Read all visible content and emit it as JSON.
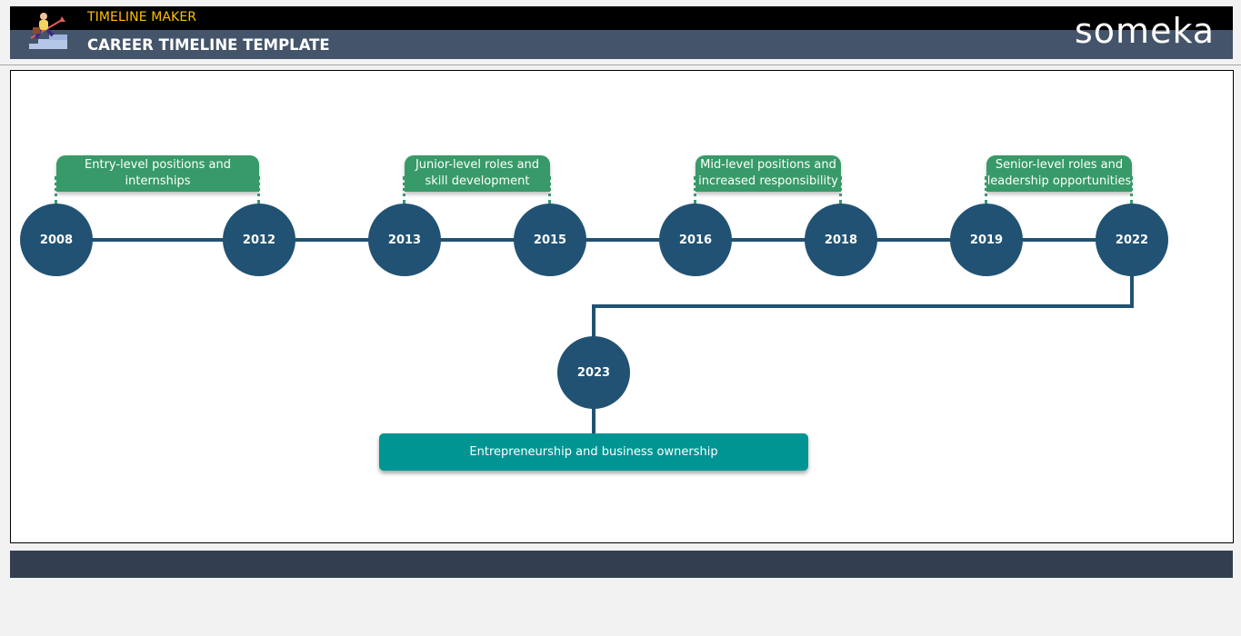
{
  "header": {
    "app_name": "TIMELINE MAKER",
    "page_title": "CAREER TIMELINE TEMPLATE",
    "brand": "someka",
    "icon": "career-stairs-icon"
  },
  "colors": {
    "node": "#215273",
    "phase_box": "#389a68",
    "final_box": "#009593",
    "header_top": "#000000",
    "header_bottom": "#44546a",
    "accent_text": "#ffc000",
    "footer": "#333f50"
  },
  "timeline": {
    "years": [
      "2008",
      "2012",
      "2013",
      "2015",
      "2016",
      "2018",
      "2019",
      "2022"
    ],
    "phases": [
      {
        "label": "Entry-level positions and internships",
        "from": "2008",
        "to": "2012"
      },
      {
        "label": "Junior-level roles and skill development",
        "from": "2013",
        "to": "2015"
      },
      {
        "label": "Mid-level positions and increased responsibility",
        "from": "2016",
        "to": "2018"
      },
      {
        "label": "Senior-level roles and leadership opportunities",
        "from": "2019",
        "to": "2022"
      }
    ],
    "final": {
      "year": "2023",
      "label": "Entrepreneurship and business ownership"
    }
  }
}
